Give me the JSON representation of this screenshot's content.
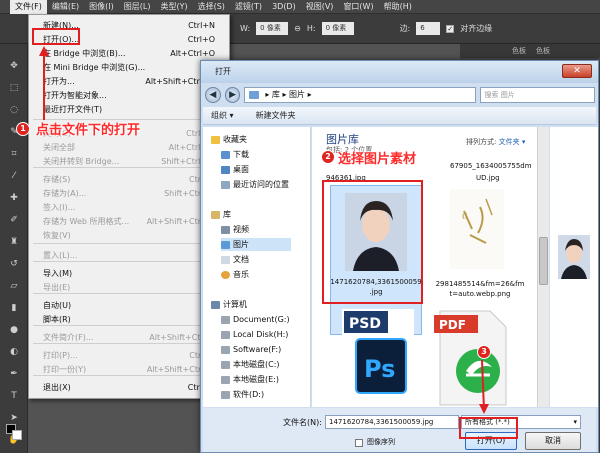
{
  "menubar": {
    "items": [
      "文件(F)",
      "编辑(E)",
      "图像(I)",
      "图层(L)",
      "类型(Y)",
      "选择(S)",
      "滤镜(T)",
      "3D(D)",
      "视图(V)",
      "窗口(W)",
      "帮助(H)"
    ]
  },
  "options": {
    "w_label": "W:",
    "w_value": "0 像素",
    "link": "⊖",
    "h_label": "H:",
    "h_value": "0 像素",
    "side_label": "边:",
    "side_value": "6",
    "align_label": "对齐边缘"
  },
  "right_panel": {
    "tabs": [
      "色板",
      "色板"
    ]
  },
  "file_menu": {
    "items": [
      {
        "label": "新建(N)...",
        "shortcut": "Ctrl+N",
        "disabled": false
      },
      {
        "label": "打开(O)...",
        "shortcut": "Ctrl+O",
        "disabled": false
      },
      {
        "label": "在 Bridge 中浏览(B)...",
        "shortcut": "Alt+Ctrl+O",
        "disabled": false
      },
      {
        "label": "在 Mini Bridge 中浏览(G)...",
        "shortcut": "",
        "disabled": false
      },
      {
        "label": "打开为...",
        "shortcut": "Alt+Shift+Ctrl+O",
        "disabled": false
      },
      {
        "label": "打开为智能对象...",
        "shortcut": "",
        "disabled": false
      },
      {
        "label": "最近打开文件(T)",
        "shortcut": "",
        "disabled": false
      },
      {
        "label": "关闭(C)",
        "shortcut": "Ctrl+W",
        "disabled": true
      },
      {
        "label": "关闭全部",
        "shortcut": "Alt+Ctrl+W",
        "disabled": true
      },
      {
        "label": "关闭并转到 Bridge...",
        "shortcut": "Shift+Ctrl+W",
        "disabled": true
      },
      {
        "label": "存储(S)",
        "shortcut": "Ctrl+S",
        "disabled": true
      },
      {
        "label": "存储为(A)...",
        "shortcut": "Shift+Ctrl+S",
        "disabled": true
      },
      {
        "label": "签入(I)...",
        "shortcut": "",
        "disabled": true
      },
      {
        "label": "存储为 Web 所用格式...",
        "shortcut": "Alt+Shift+Ctrl+S",
        "disabled": true
      },
      {
        "label": "恢复(V)",
        "shortcut": "F12",
        "disabled": true
      },
      {
        "label": "置入(L)...",
        "shortcut": "",
        "disabled": true
      },
      {
        "label": "导入(M)",
        "shortcut": "",
        "disabled": false
      },
      {
        "label": "导出(E)",
        "shortcut": "",
        "disabled": true
      },
      {
        "label": "自动(U)",
        "shortcut": "",
        "disabled": false
      },
      {
        "label": "脚本(R)",
        "shortcut": "",
        "disabled": false
      },
      {
        "label": "文件简介(F)...",
        "shortcut": "Alt+Shift+Ctrl+I",
        "disabled": true
      },
      {
        "label": "打印(P)...",
        "shortcut": "Ctrl+P",
        "disabled": true
      },
      {
        "label": "打印一份(Y)",
        "shortcut": "Alt+Shift+Ctrl+P",
        "disabled": true
      },
      {
        "label": "退出(X)",
        "shortcut": "Ctrl+Q",
        "disabled": false
      }
    ]
  },
  "annotations": {
    "step1": {
      "num": "1",
      "text": "点击文件下的打开"
    },
    "step2": {
      "num": "2",
      "text": "选择图片素材"
    },
    "step3": {
      "num": "3"
    }
  },
  "dialog": {
    "title": "打开",
    "close": "✕",
    "back": "◀",
    "forward": "▶",
    "address": "▸ 库 ▸ 图片 ▸",
    "search_placeholder": "搜索 图片",
    "organize": "组织 ▾",
    "new_folder": "新建文件夹",
    "nav": {
      "favorites": "收藏夹",
      "downloads": "下载",
      "desktop": "桌面",
      "recent": "最近访问的位置",
      "libraries": "库",
      "videos": "视频",
      "pictures": "图片",
      "documents": "文档",
      "music": "音乐",
      "computer": "计算机",
      "drive_g": "Document(G:)",
      "drive_e": "Local Disk(H:)",
      "drive_f": "Software(F:)",
      "drive_c": "本地磁盘(C:)",
      "drive_d": "本地磁盘(E:)",
      "more": "软件(D:)"
    },
    "library": {
      "title": "图片库",
      "subtitle": "包括: 2 个位置",
      "arrange_label": "排列方式:",
      "arrange_value": "文件夹 ▾"
    },
    "files": {
      "top_left": "946361.jpg",
      "top_right_1": "67905_1634005755dm",
      "top_right_2": "UD.jpg",
      "f1_line1": "1471620784,3361500059",
      "f1_line2": ".jpg",
      "f2_line1": "2981485514&fm=26&fm",
      "f2_line2": "t=auto.webp.png",
      "psd_label": "PSD",
      "ps_label": "Ps",
      "pdf_label": "PDF"
    },
    "filename_label": "文件名(N):",
    "filename_value": "1471620784,3361500059.jpg",
    "filetype_value": "所有格式 (*.*)",
    "sequence_label": "图像序列",
    "open_button": "打开(O)",
    "cancel_button": "取消"
  },
  "colors": {
    "accent_red": "#e02020",
    "dialog_blue": "#cfdff0"
  }
}
